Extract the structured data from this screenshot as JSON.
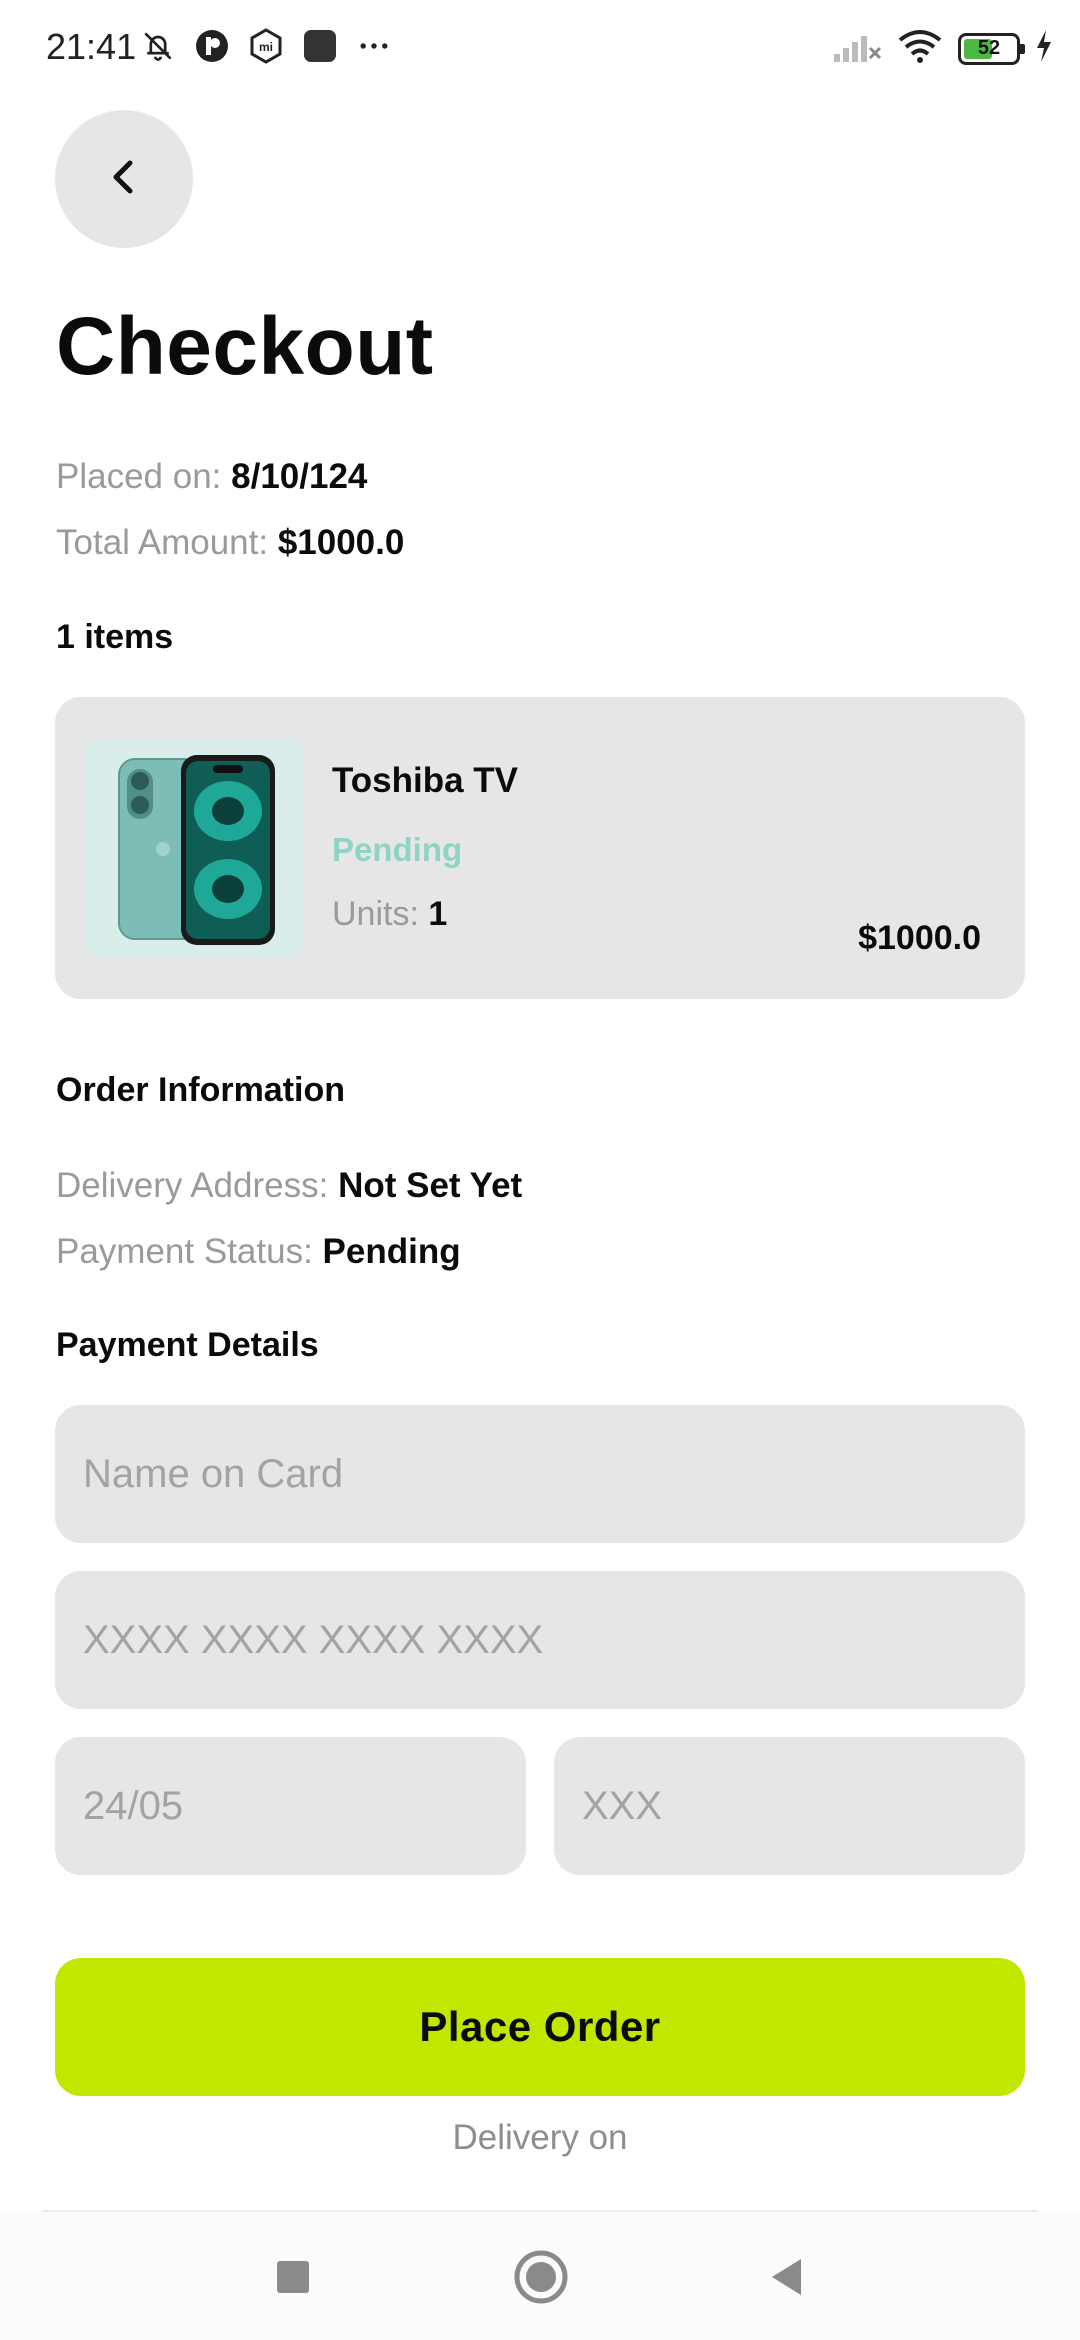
{
  "status_bar": {
    "time": "21:41",
    "left_icons": [
      "muted-bell-icon",
      "app-icon-p",
      "mi-icon",
      "square-app-icon",
      "more-dots-icon"
    ],
    "battery_level": "52",
    "right_icons": [
      "signal-icon",
      "wifi-icon",
      "battery-icon",
      "charging-icon"
    ]
  },
  "header": {
    "back_icon": "chevron-left-icon",
    "title": "Checkout"
  },
  "order": {
    "placed_label": "Placed on:",
    "placed_value": "8/10/124",
    "total_label": "Total Amount:",
    "total_value": "$1000.0",
    "items_count": "1 items"
  },
  "item": {
    "name": "Toshiba TV",
    "status": "Pending",
    "units_label": "Units:",
    "units_value": "1",
    "price": "$1000.0",
    "status_color": "#8fd2c6"
  },
  "order_info": {
    "heading": "Order Information",
    "address_label": "Delivery Address:",
    "address_value": "Not Set Yet",
    "payment_label": "Payment Status:",
    "payment_value": "Pending"
  },
  "payment": {
    "heading": "Payment Details",
    "name_placeholder": "Name on Card",
    "card_placeholder": "XXXX XXXX XXXX XXXX",
    "expiry_placeholder": "24/05",
    "cvv_placeholder": "XXX"
  },
  "actions": {
    "place_order": "Place Order",
    "delivery_text": "Delivery on",
    "accent_color": "#c3e600"
  },
  "navbar": {
    "items": [
      "recents-square-icon",
      "home-circle-icon",
      "back-triangle-icon"
    ]
  }
}
